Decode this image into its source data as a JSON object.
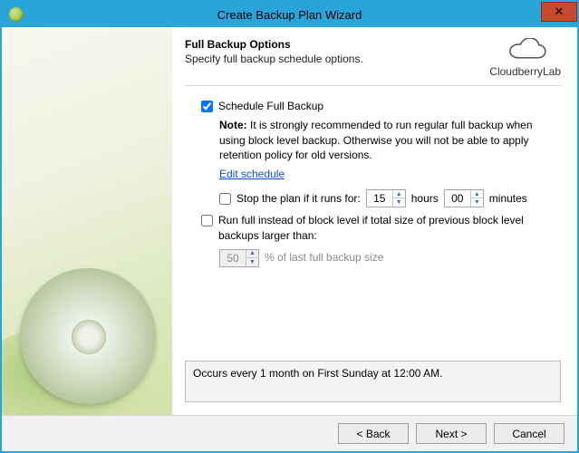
{
  "window": {
    "title": "Create Backup Plan Wizard",
    "close_glyph": "✕"
  },
  "header": {
    "title": "Full Backup Options",
    "subtitle": "Specify full backup schedule options.",
    "brand": "CloudberryLab"
  },
  "form": {
    "schedule_label": "Schedule Full Backup",
    "schedule_checked": true,
    "note_prefix": "Note:",
    "note_body": "It is strongly recommended to run regular full backup when using block level backup. Otherwise you will not be able to apply retention policy for old versions.",
    "edit_link": "Edit schedule",
    "stop_checked": false,
    "stop_label": "Stop the plan if it runs for:",
    "stop_hours": "15",
    "stop_hours_unit": "hours",
    "stop_minutes": "00",
    "stop_minutes_unit": "minutes",
    "runfull_checked": false,
    "runfull_label": "Run full instead of block level if total size of previous block level backups larger than:",
    "runfull_percent": "50",
    "runfull_suffix": "% of last full backup size"
  },
  "summary": "Occurs every 1 month on First Sunday at 12:00 AM.",
  "buttons": {
    "back": "< Back",
    "next": "Next >",
    "cancel": "Cancel"
  }
}
